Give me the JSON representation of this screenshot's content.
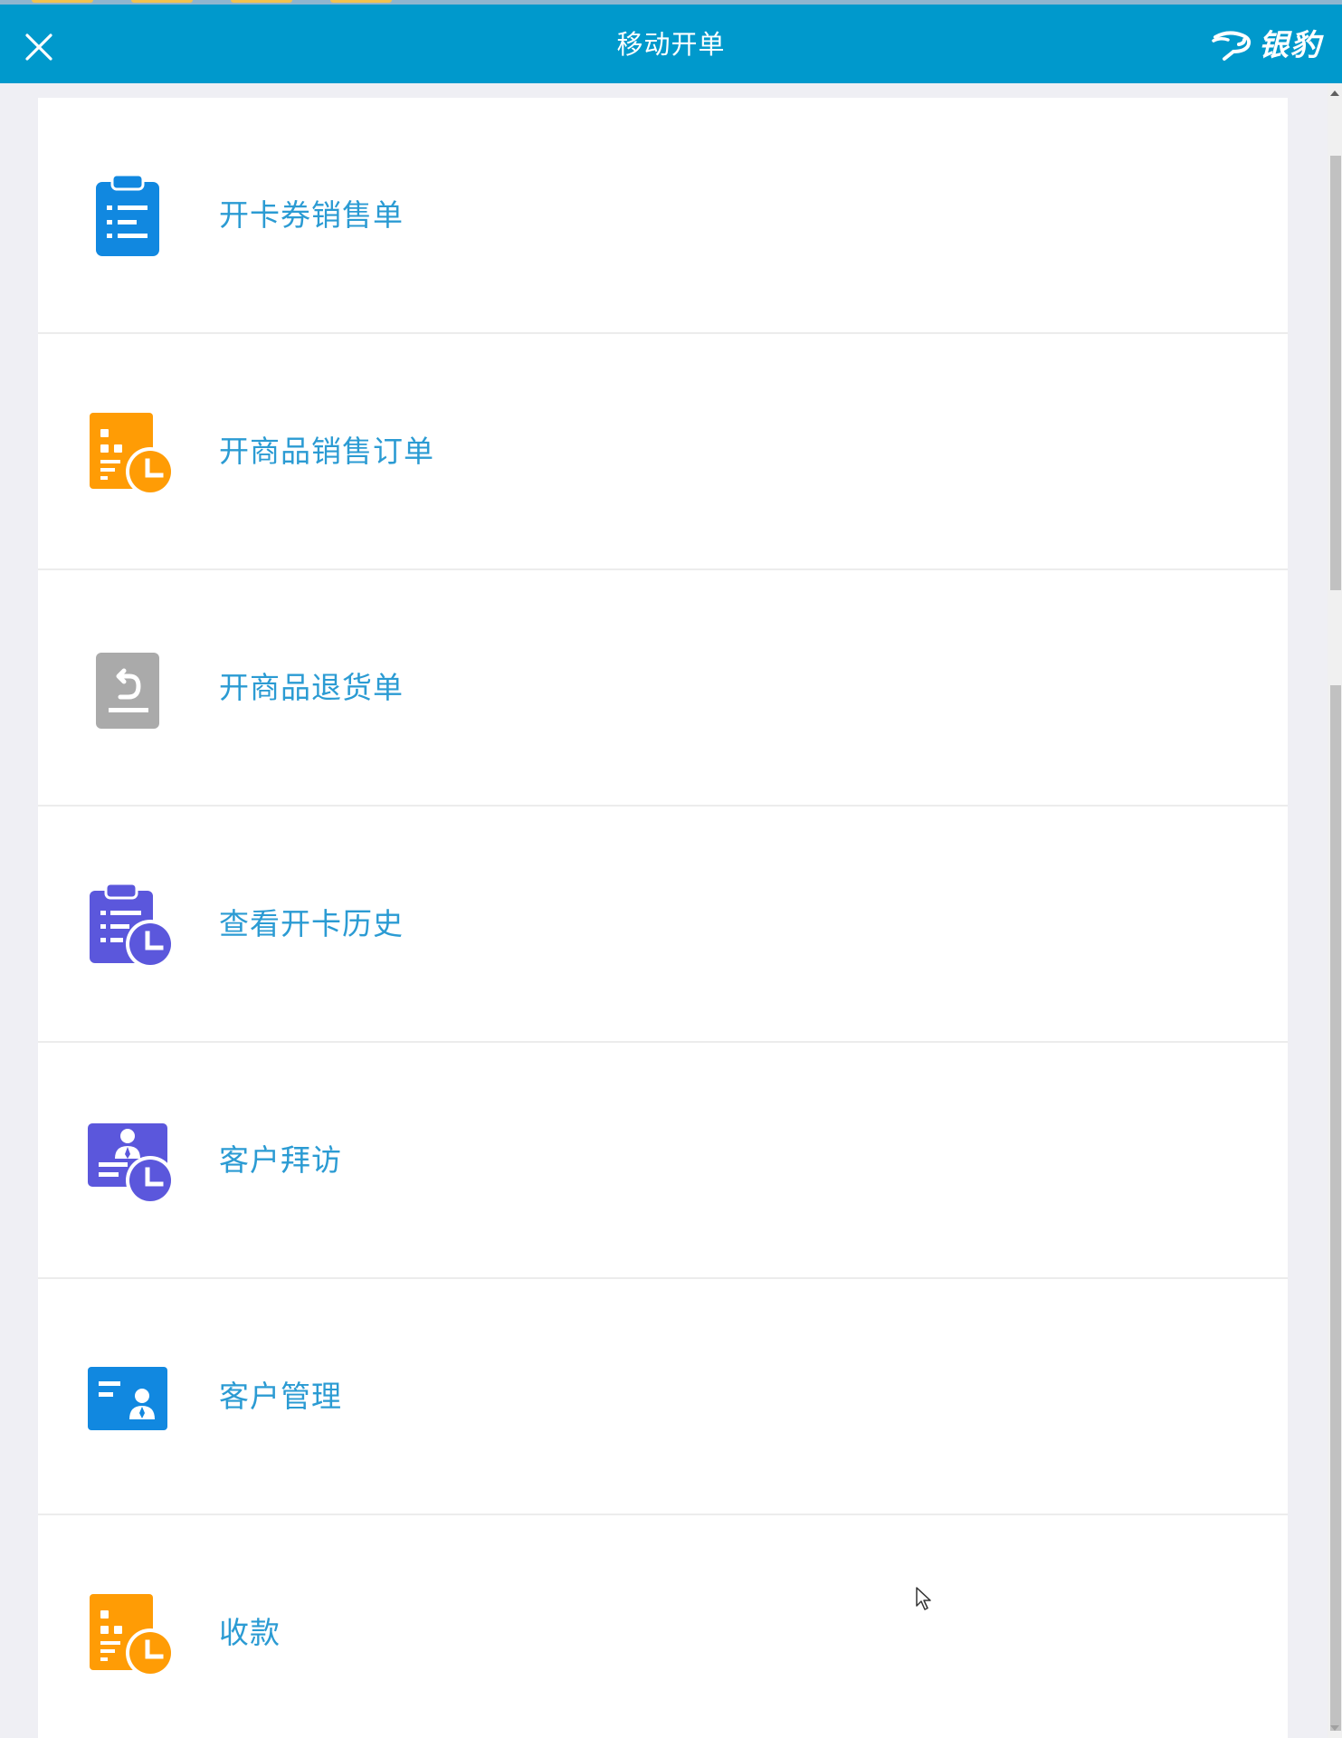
{
  "window": {
    "title": "移动开单",
    "brand_name": "银豹"
  },
  "icons": {
    "close": "close-icon",
    "brand": "leopard-logo-icon"
  },
  "colors": {
    "header_bg": "#0099cc",
    "label_text": "#2b9bd3",
    "blue": "#1188e0",
    "orange": "#ff9c05",
    "gray": "#aaaaaa",
    "purple": "#5b57dc"
  },
  "menu": {
    "items": [
      {
        "label": "开卡券销售单",
        "icon": "clipboard-list-icon"
      },
      {
        "label": "开商品销售订单",
        "icon": "order-clock-icon"
      },
      {
        "label": "开商品退货单",
        "icon": "return-document-icon"
      },
      {
        "label": "查看开卡历史",
        "icon": "clipboard-clock-icon"
      },
      {
        "label": "客户拜访",
        "icon": "visit-clock-icon"
      },
      {
        "label": "客户管理",
        "icon": "customer-card-icon"
      },
      {
        "label": "收款",
        "icon": "payment-clock-icon"
      }
    ]
  }
}
